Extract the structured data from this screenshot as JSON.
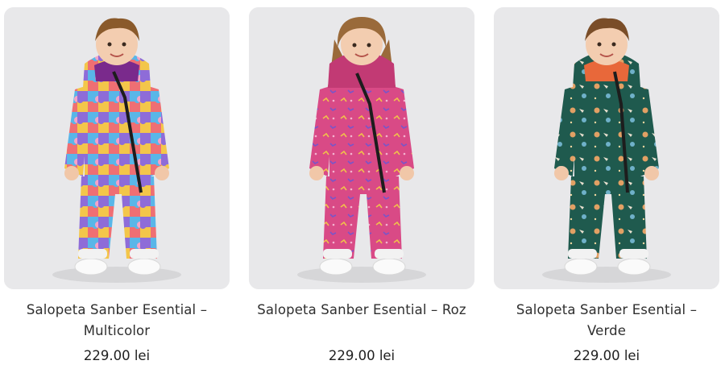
{
  "products": [
    {
      "title": "Salopeta Sanber Esential – Multicolor",
      "price": "229.00 lei",
      "image": "child-multicolor-jumpsuit",
      "colors": {
        "suit": "#4aa3d8",
        "hood": "#7a2a8c",
        "hair": "#8a5a2b"
      }
    },
    {
      "title": "Salopeta Sanber Esential – Roz",
      "price": "229.00 lei",
      "image": "child-pink-jumpsuit",
      "colors": {
        "suit": "#d94a86",
        "hood": "#c23a74",
        "hair": "#9a6a3a"
      }
    },
    {
      "title": "Salopeta Sanber Esential – Verde",
      "price": "229.00 lei",
      "image": "child-green-jumpsuit",
      "colors": {
        "suit": "#1f5a4e",
        "hood": "#e8683a",
        "hair": "#7a4d28"
      }
    }
  ]
}
